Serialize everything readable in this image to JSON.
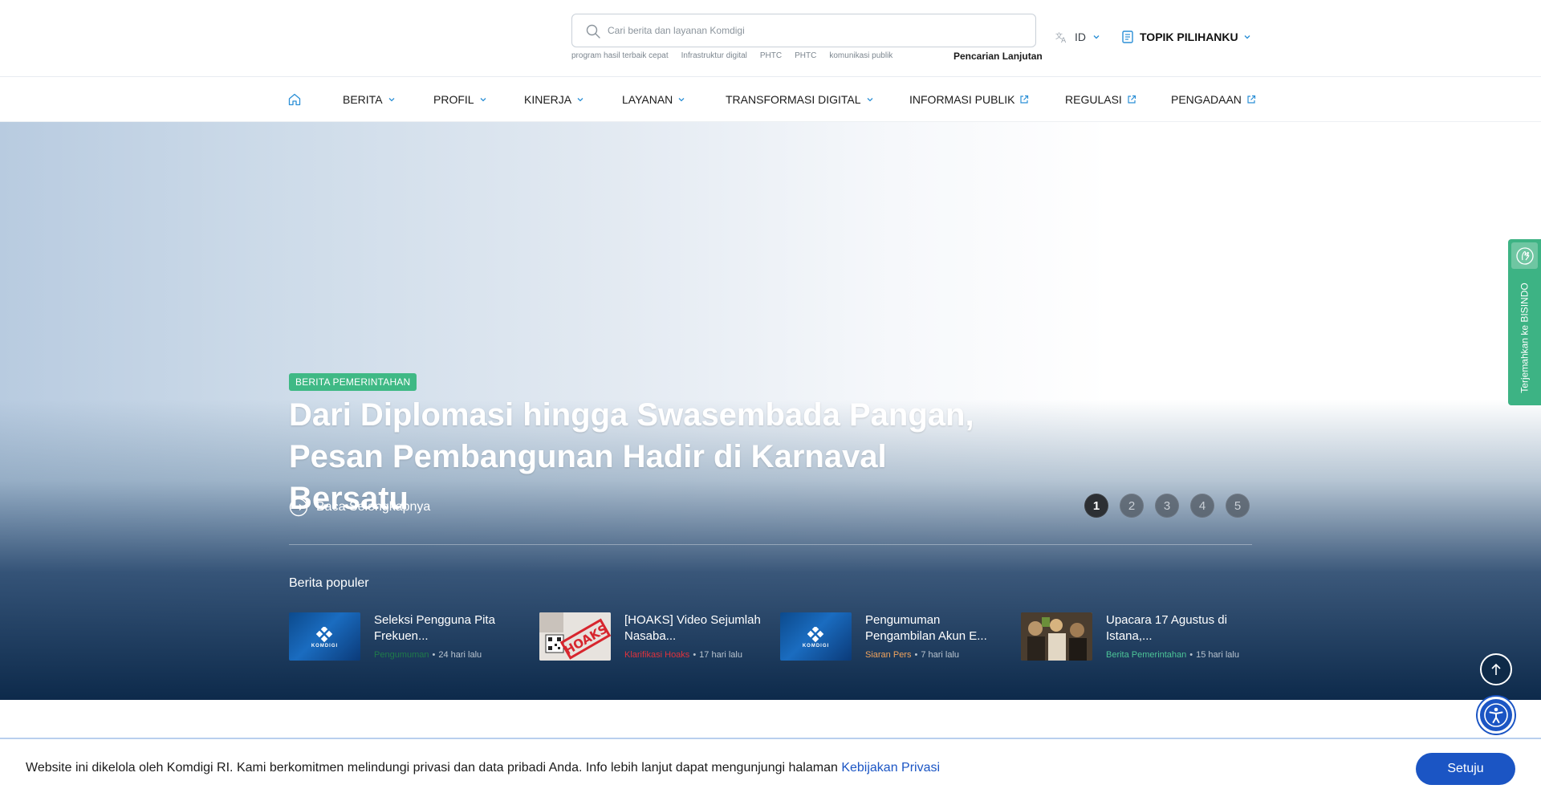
{
  "header": {
    "search": {
      "placeholder": "Cari berita dan layanan Komdigi"
    },
    "quick_tags": [
      "program hasil terbaik cepat",
      "Infrastruktur digital",
      "PHTC",
      "PHTC",
      "komunikasi publik"
    ],
    "advanced_search": "Pencarian Lanjutan",
    "language": "ID",
    "topik": "TOPIK PILIHANKU"
  },
  "nav": {
    "items": [
      {
        "label": "BERITA",
        "type": "dropdown"
      },
      {
        "label": "PROFIL",
        "type": "dropdown"
      },
      {
        "label": "KINERJA",
        "type": "dropdown"
      },
      {
        "label": "LAYANAN",
        "type": "dropdown"
      },
      {
        "label": "TRANSFORMASI DIGITAL",
        "type": "dropdown"
      },
      {
        "label": "INFORMASI PUBLIK",
        "type": "external"
      },
      {
        "label": "REGULASI",
        "type": "external"
      },
      {
        "label": "PENGADAAN",
        "type": "external"
      }
    ]
  },
  "hero": {
    "badge": "BERITA PEMERINTAHAN",
    "title_line1": "Dari Diplomasi hingga Swasembada Pangan,",
    "title_line2": "Pesan Pembangunan Hadir di Karnaval Bersatu",
    "read_more": "Baca Selengkapnya",
    "pages": [
      "1",
      "2",
      "3",
      "4",
      "5"
    ],
    "active_page": "1"
  },
  "popular": {
    "heading": "Berita populer",
    "items": [
      {
        "title": "Seleksi Pengguna Pita Frekuen...",
        "category": "Pengumuman",
        "category_color": "#1f7a4a",
        "time": "24 hari lalu",
        "thumb": "komdigi-logo"
      },
      {
        "title": "[HOAKS] Video Sejumlah Nasaba...",
        "category": "Klarifikasi Hoaks",
        "category_color": "#e0323c",
        "time": "17 hari lalu",
        "thumb": "hoaks-stamp"
      },
      {
        "title": "Pengumuman Pengambilan Akun E...",
        "category": "Siaran Pers",
        "category_color": "#f0a35c",
        "time": "7 hari lalu",
        "thumb": "komdigi-logo"
      },
      {
        "title": "Upacara 17 Agustus di Istana,...",
        "category": "Berita Pemerintahan",
        "category_color": "#4cc497",
        "time": "15 hari lalu",
        "thumb": "photo"
      }
    ],
    "thumb_logo_text": "KOMDIGI",
    "hoaks_text": "HOAKS"
  },
  "bisindo": {
    "label": "Terjemahkan ke BISINDO"
  },
  "cookie": {
    "text": "Website ini dikelola oleh Komdigi RI. Kami berkomitmen melindungi privasi dan data pribadi Anda. Info lebih lanjut dapat mengunjungi halaman ",
    "link": "Kebijakan Privasi",
    "button": "Setuju"
  },
  "colors": {
    "accent_blue": "#1b55c4",
    "badge_green": "#3fb985",
    "nav_link_icon": "#2b8fd6"
  }
}
